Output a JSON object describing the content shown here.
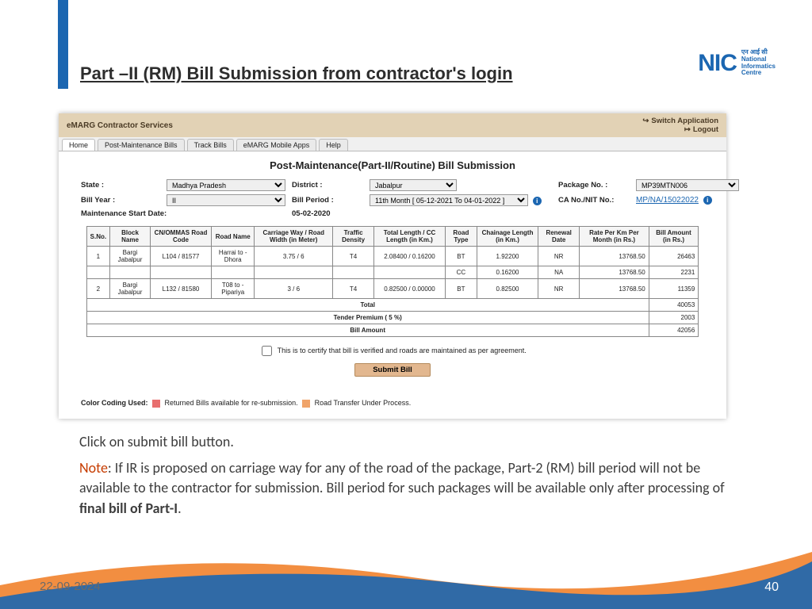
{
  "slide": {
    "title": "Part –II (RM) Bill Submission from contractor's login",
    "logo_text": "NIC",
    "logo_sub1": "एन आई सी",
    "logo_sub2": "National",
    "logo_sub3": "Informatics",
    "logo_sub4": "Centre",
    "footer_date": "22-09-2024",
    "page_no": "40"
  },
  "app": {
    "brand": "eMARG   Contractor Services",
    "switch": "Switch Application",
    "logout": "Logout",
    "tabs": [
      "Home",
      "Post-Maintenance Bills",
      "Track Bills",
      "eMARG Mobile Apps",
      "Help"
    ],
    "heading": "Post-Maintenance(Part-II/Routine) Bill Submission",
    "form": {
      "state_lbl": "State :",
      "state_val": "Madhya Pradesh",
      "district_lbl": "District :",
      "district_val": "Jabalpur",
      "package_lbl": "Package No. :",
      "package_val": "MP39MTN006",
      "year_lbl": "Bill Year :",
      "year_val": "II",
      "period_lbl": "Bill Period :",
      "period_val": "11th Month [ 05-12-2021 To 04-01-2022 ]",
      "ca_lbl": "CA No./NIT No.:",
      "ca_val": "MP/NA/15022022",
      "mstart_lbl": "Maintenance Start Date:",
      "mstart_val": "05-02-2020"
    },
    "headers": [
      "S.No.",
      "Block Name",
      "CN/OMMAS Road Code",
      "Road Name",
      "Carriage Way / Road Width (in Meter)",
      "Traffic Density",
      "Total Length / CC Length (in Km.)",
      "Road Type",
      "Chainage Length (in Km.)",
      "Renewal Date",
      "Rate Per Km Per Month (in Rs.)",
      "Bill Amount (in Rs.)"
    ],
    "rows": [
      {
        "sno": "1",
        "block": "Bargi Jabalpur",
        "code": "L104 / 81577",
        "road": "Harrai to - Dhora",
        "cw": "3.75 / 6",
        "td": "T4",
        "tl": "2.08400 / 0.16200",
        "rt": "BT",
        "cl": "1.92200",
        "rd": "NR",
        "rate": "13768.50",
        "amt": "26463"
      },
      {
        "sno": "",
        "block": "",
        "code": "",
        "road": "",
        "cw": "",
        "td": "",
        "tl": "",
        "rt": "CC",
        "cl": "0.16200",
        "rd": "NA",
        "rate": "13768.50",
        "amt": "2231"
      },
      {
        "sno": "2",
        "block": "Bargi Jabalpur",
        "code": "L132 / 81580",
        "road": "T08 to - Pipariya",
        "cw": "3 / 6",
        "td": "T4",
        "tl": "0.82500 / 0.00000",
        "rt": "BT",
        "cl": "0.82500",
        "rd": "NR",
        "rate": "13768.50",
        "amt": "11359"
      }
    ],
    "summary": {
      "total_lbl": "Total",
      "total_val": "40053",
      "premium_lbl": "Tender Premium ( 5 %)",
      "premium_val": "2003",
      "bill_lbl": "Bill Amount",
      "bill_val": "42056"
    },
    "certify": "This is to certify that bill is verified and roads are maintained as per agreement.",
    "submit": "Submit Bill",
    "legend_lbl": "Color Coding Used:",
    "legend1": "Returned Bills available for re-submission.",
    "legend2": "Road Transfer Under Process.",
    "swatch1": "#e86f6f",
    "swatch2": "#f0a46a"
  },
  "narr": {
    "line1": "Click on submit bill button.",
    "note": "Note",
    "line2_a": ": If IR is proposed on carriage way for any of the road of the package, Part-2 (RM) bill period will not be available to the contractor for submission. Bill period for such packages will be available only after processing of ",
    "bold": "final bill of Part-I",
    "line2_b": "."
  }
}
